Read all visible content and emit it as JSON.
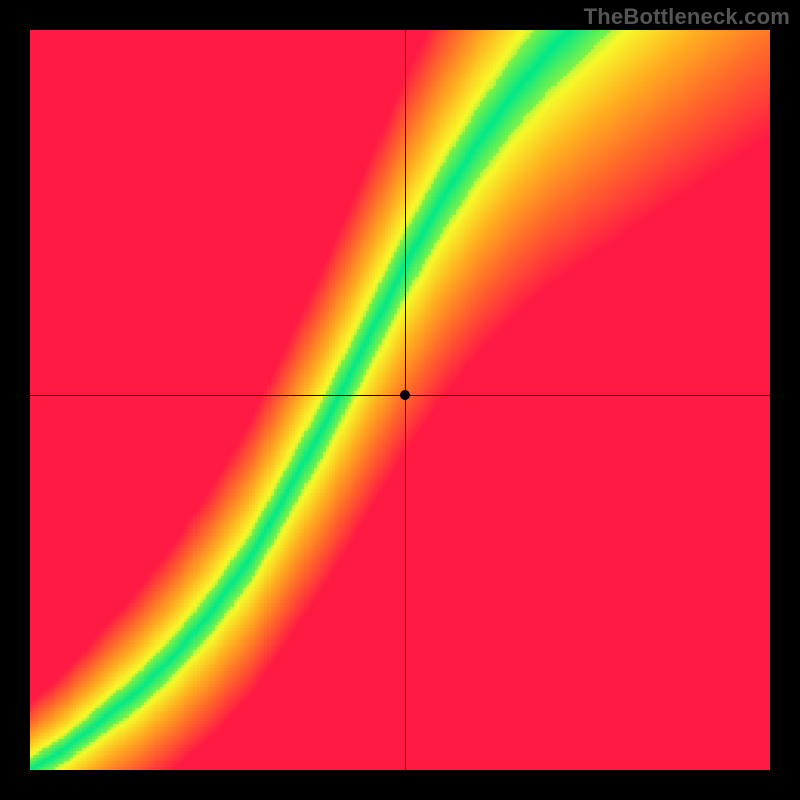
{
  "watermark": "TheBottleneck.com",
  "chart_data": {
    "type": "heatmap",
    "title": "",
    "xlabel": "",
    "ylabel": "",
    "xlim": [
      0,
      1
    ],
    "ylim": [
      0,
      1
    ],
    "grid": false,
    "legend": false,
    "crosshair": {
      "x": 0.507,
      "y": 0.507
    },
    "dot": {
      "x": 0.507,
      "y": 0.507
    },
    "color_stops": [
      {
        "t": 0.0,
        "color": "#00e889"
      },
      {
        "t": 0.1,
        "color": "#6bf050"
      },
      {
        "t": 0.22,
        "color": "#f7f92a"
      },
      {
        "t": 0.45,
        "color": "#ffb020"
      },
      {
        "t": 0.7,
        "color": "#ff6a2a"
      },
      {
        "t": 1.0,
        "color": "#ff1a44"
      }
    ],
    "optimal_curve": [
      {
        "x": 0.0,
        "y": 0.0
      },
      {
        "x": 0.05,
        "y": 0.03
      },
      {
        "x": 0.1,
        "y": 0.07
      },
      {
        "x": 0.15,
        "y": 0.11
      },
      {
        "x": 0.2,
        "y": 0.16
      },
      {
        "x": 0.25,
        "y": 0.22
      },
      {
        "x": 0.3,
        "y": 0.29
      },
      {
        "x": 0.35,
        "y": 0.38
      },
      {
        "x": 0.4,
        "y": 0.47
      },
      {
        "x": 0.45,
        "y": 0.57
      },
      {
        "x": 0.5,
        "y": 0.67
      },
      {
        "x": 0.55,
        "y": 0.76
      },
      {
        "x": 0.6,
        "y": 0.84
      },
      {
        "x": 0.65,
        "y": 0.91
      },
      {
        "x": 0.7,
        "y": 0.97
      },
      {
        "x": 0.73,
        "y": 1.0
      }
    ],
    "band_width_norm": 0.06,
    "resolution": 240
  }
}
